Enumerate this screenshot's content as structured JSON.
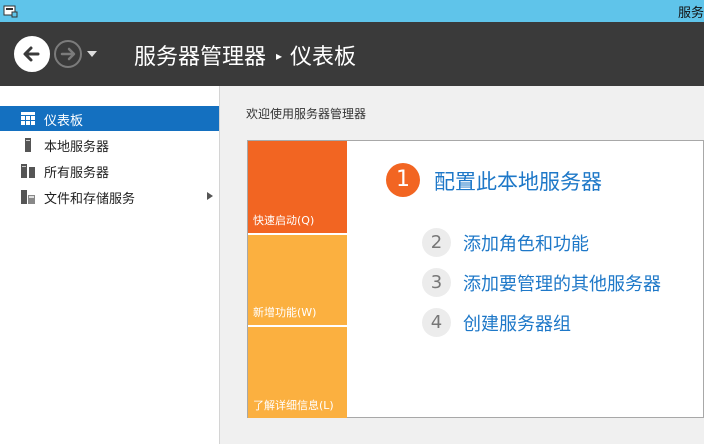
{
  "window": {
    "title": "服务"
  },
  "header": {
    "breadcrumb_root": "服务器管理器",
    "breadcrumb_separator": "▸",
    "breadcrumb_current": "仪表板"
  },
  "sidebar": {
    "items": [
      {
        "label": "仪表板",
        "icon": "dashboard-grid-icon",
        "active": true
      },
      {
        "label": "本地服务器",
        "icon": "server-icon"
      },
      {
        "label": "所有服务器",
        "icon": "servers-icon"
      },
      {
        "label": "文件和存储服务",
        "icon": "file-storage-icon",
        "has_submenu": true
      }
    ]
  },
  "main": {
    "welcome": "欢迎使用服务器管理器",
    "tiles": [
      {
        "label": "快速启动(Q)",
        "color": "#f26522"
      },
      {
        "label": "新增功能(W)",
        "color": "#fbb040"
      },
      {
        "label": "了解详细信息(L)",
        "color": "#fbb040"
      }
    ],
    "steps": [
      {
        "num": "1",
        "label": "配置此本地服务器"
      },
      {
        "num": "2",
        "label": "添加角色和功能"
      },
      {
        "num": "3",
        "label": "添加要管理的其他服务器"
      },
      {
        "num": "4",
        "label": "创建服务器组"
      }
    ]
  },
  "colors": {
    "titlebar": "#5fc4ea",
    "header": "#3a3a3a",
    "accent": "#1470c0",
    "link": "#1e78c8",
    "orange": "#f26522",
    "amber": "#fbb040"
  }
}
